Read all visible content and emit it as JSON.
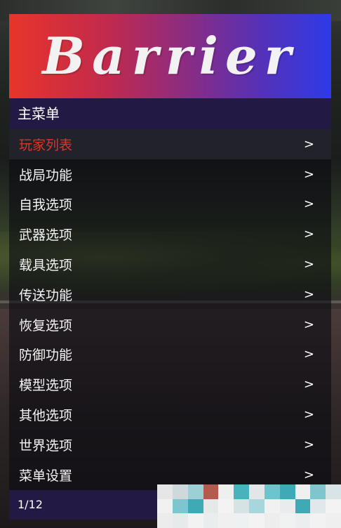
{
  "menu": {
    "title": "Barrier",
    "header": "主菜单",
    "items": [
      {
        "label": "玩家列表",
        "arrow": ">",
        "selected": true
      },
      {
        "label": "战局功能",
        "arrow": ">"
      },
      {
        "label": "自我选项",
        "arrow": ">"
      },
      {
        "label": "武器选项",
        "arrow": ">"
      },
      {
        "label": "载具选项",
        "arrow": ">"
      },
      {
        "label": "传送功能",
        "arrow": ">"
      },
      {
        "label": "恢复选项",
        "arrow": ">"
      },
      {
        "label": "防御功能",
        "arrow": ">"
      },
      {
        "label": "模型选项",
        "arrow": ">"
      },
      {
        "label": "其他选项",
        "arrow": ">"
      },
      {
        "label": "世界选项",
        "arrow": ">"
      },
      {
        "label": "菜单设置",
        "arrow": ">"
      }
    ],
    "footer": "1/12"
  },
  "colors": {
    "banner_gradient": [
      "#e8352a",
      "#8b2c82",
      "#2e3ae8"
    ],
    "header_bg": "#221a44",
    "selected_text": "#e0332b",
    "item_text": "#f4f4f4"
  }
}
